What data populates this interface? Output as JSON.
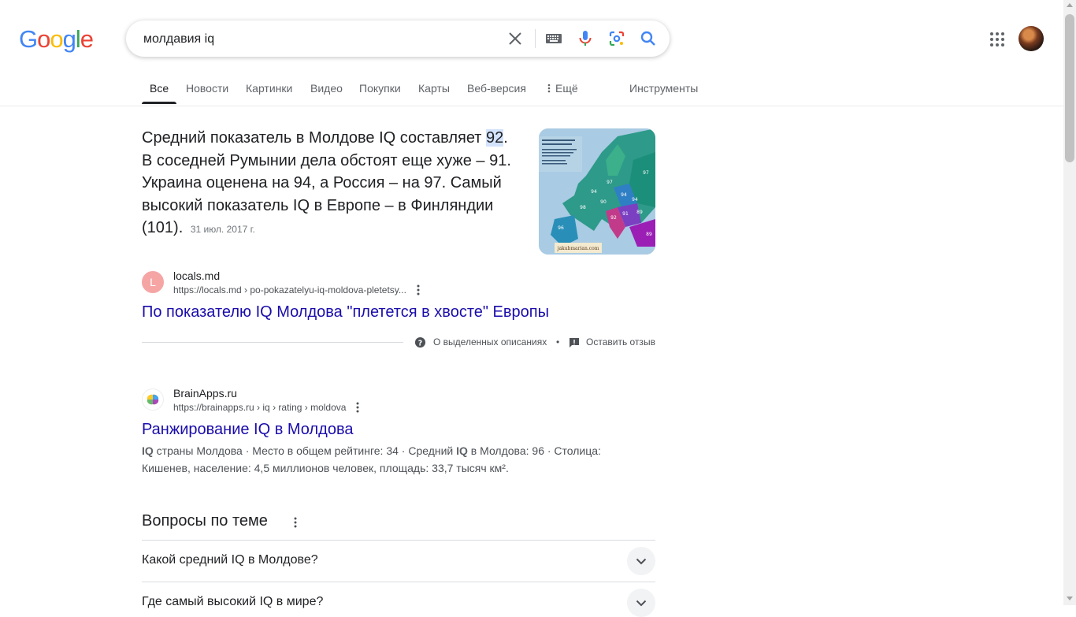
{
  "logo": {
    "letters": [
      "G",
      "o",
      "o",
      "g",
      "l",
      "e"
    ],
    "colors": [
      "#4285f4",
      "#ea4335",
      "#fbbc05",
      "#4285f4",
      "#34a853",
      "#ea4335"
    ]
  },
  "search": {
    "query": "молдавия iq"
  },
  "tabs": [
    "Все",
    "Новости",
    "Картинки",
    "Видео",
    "Покупки",
    "Карты",
    "Веб-версия",
    "Ещё",
    "Инструменты"
  ],
  "snippet": {
    "before": "Средний показатель в Молдове IQ составляет ",
    "highlight": "92",
    "after": ". В соседней Румынии дела обстоят еще хуже – 91. Украина оценена на 94, а Россия – на 97. Самый высокий показатель IQ в Европе – в Финляндии (101).",
    "date": "31 июл. 2017 г.",
    "image": {
      "map_labels": [
        "97",
        "94",
        "98",
        "90",
        "97",
        "94",
        "91",
        "89",
        "96",
        "92",
        "94",
        "89"
      ],
      "caption": "jakubmarian.com"
    }
  },
  "result1": {
    "favicon_letter": "L",
    "site": "locals.md",
    "url": "https://locals.md › po-pokazatelyu-iq-moldova-pletetsy...",
    "title": "По показателю IQ Молдова \"плетется в хвосте\" Европы"
  },
  "feedback": {
    "about": "О выделенных описаниях",
    "separator": "•",
    "leave": "Оставить отзыв"
  },
  "result2": {
    "site": "BrainApps.ru",
    "url": "https://brainapps.ru › iq › rating › moldova",
    "title": "Ранжирование IQ в Молдова",
    "desc_b1": "IQ",
    "desc_t1": " страны Молдова · Место в общем рейтинге: 34 · Средний ",
    "desc_b2": "IQ",
    "desc_t2": " в Молдова: 96 · Столица: Кишенев, население: 4,5 миллионов человек, площадь: 33,7 тысяч км²."
  },
  "paa": {
    "title": "Вопросы по теме",
    "questions": [
      "Какой средний IQ в Молдове?",
      "Где самый высокий IQ в мире?"
    ]
  }
}
